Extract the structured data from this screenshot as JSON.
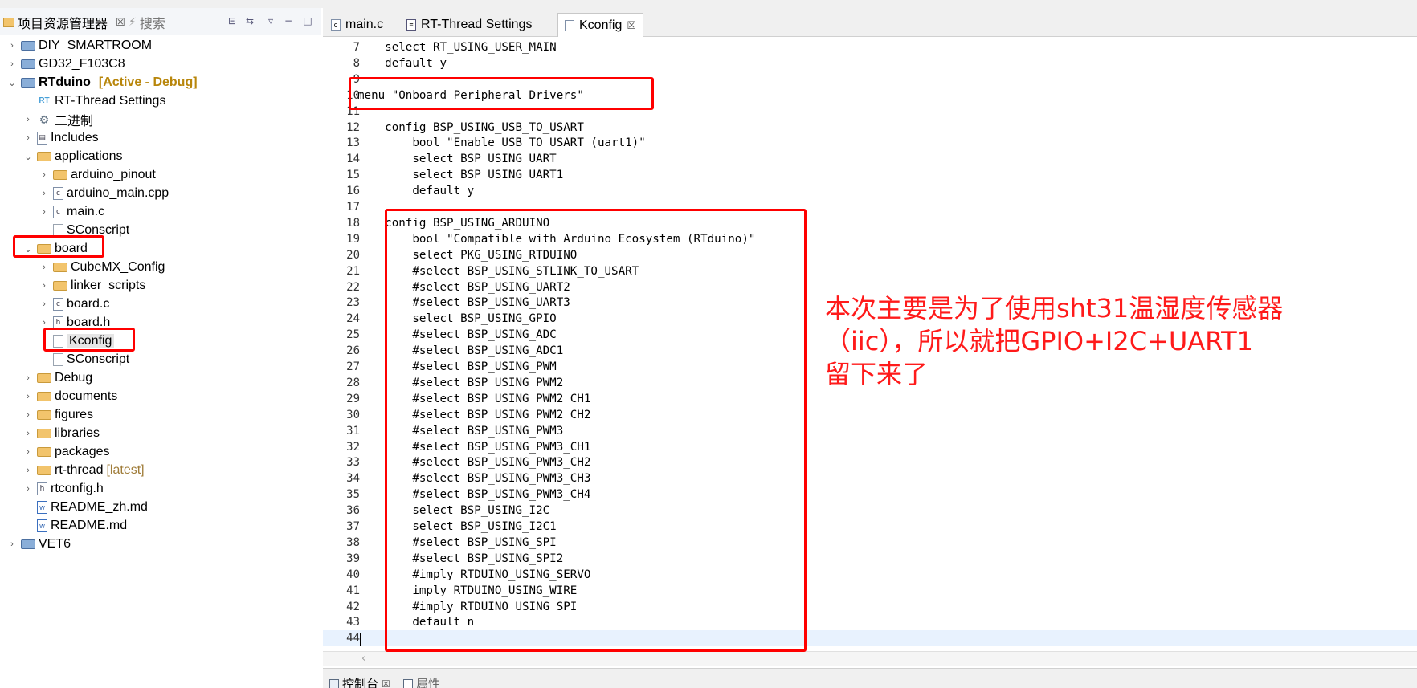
{
  "left_panel": {
    "tabs": [
      {
        "label": "项目资源管理器",
        "close": "☒"
      },
      {
        "label": "搜索"
      }
    ],
    "tree": [
      {
        "label": "DIY_SMARTROOM",
        "icon": "project-icon",
        "chev": "›",
        "indent": 0
      },
      {
        "label": "GD32_F103C8",
        "icon": "project-icon",
        "chev": "›",
        "indent": 0
      },
      {
        "label": "RTduino",
        "icon": "project-icon",
        "chev": "⌄",
        "indent": 0,
        "decoration": "[Active - Debug]"
      },
      {
        "label": "RT-Thread Settings",
        "icon": "rt-settings-icon",
        "chev": "",
        "indent": 1
      },
      {
        "label": "二进制",
        "icon": "binaries-icon",
        "chev": "›",
        "indent": 1
      },
      {
        "label": "Includes",
        "icon": "includes-icon",
        "chev": "›",
        "indent": 1
      },
      {
        "label": "applications",
        "icon": "folder-icon",
        "chev": "⌄",
        "indent": 1
      },
      {
        "label": "arduino_pinout",
        "icon": "folder-icon",
        "chev": "›",
        "indent": 2
      },
      {
        "label": "arduino_main.cpp",
        "icon": "c-file-icon",
        "chev": "›",
        "indent": 2
      },
      {
        "label": "main.c",
        "icon": "c-file-icon",
        "chev": "›",
        "indent": 2
      },
      {
        "label": "SConscript",
        "icon": "file-icon",
        "chev": "",
        "indent": 2
      },
      {
        "label": "board",
        "icon": "folder-icon",
        "chev": "⌄",
        "indent": 1
      },
      {
        "label": "CubeMX_Config",
        "icon": "folder-icon",
        "chev": "›",
        "indent": 2
      },
      {
        "label": "linker_scripts",
        "icon": "folder-icon",
        "chev": "›",
        "indent": 2
      },
      {
        "label": "board.c",
        "icon": "c-file-icon",
        "chev": "›",
        "indent": 2
      },
      {
        "label": "board.h",
        "icon": "h-file-icon",
        "chev": "›",
        "indent": 2
      },
      {
        "label": "Kconfig",
        "icon": "file-icon",
        "chev": "",
        "indent": 2,
        "selected": true
      },
      {
        "label": "SConscript",
        "icon": "file-icon",
        "chev": "",
        "indent": 2
      },
      {
        "label": "Debug",
        "icon": "folder-icon",
        "chev": "›",
        "indent": 1
      },
      {
        "label": "documents",
        "icon": "folder-icon",
        "chev": "›",
        "indent": 1
      },
      {
        "label": "figures",
        "icon": "folder-icon",
        "chev": "›",
        "indent": 1
      },
      {
        "label": "libraries",
        "icon": "folder-icon",
        "chev": "›",
        "indent": 1
      },
      {
        "label": "packages",
        "icon": "folder-icon",
        "chev": "›",
        "indent": 1
      },
      {
        "label": "rt-thread",
        "icon": "folder-icon",
        "chev": "›",
        "indent": 1,
        "decoration": "[latest]"
      },
      {
        "label": "rtconfig.h",
        "icon": "h-file-icon",
        "chev": "›",
        "indent": 1
      },
      {
        "label": "README_zh.md",
        "icon": "word-file-icon",
        "chev": "",
        "indent": 1
      },
      {
        "label": "README.md",
        "icon": "word-file-icon",
        "chev": "",
        "indent": 1
      },
      {
        "label": "VET6",
        "icon": "project-icon",
        "chev": "›",
        "indent": 0
      }
    ]
  },
  "editor": {
    "tabs": [
      {
        "label": "main.c",
        "icon": "c-file-icon",
        "active": false
      },
      {
        "label": "RT-Thread Settings",
        "icon": "rt-settings-icon",
        "active": false
      },
      {
        "label": "Kconfig",
        "icon": "file-icon",
        "active": true,
        "close": "☒"
      }
    ],
    "lines": [
      {
        "n": "7",
        "text": "    select RT_USING_USER_MAIN"
      },
      {
        "n": "8",
        "text": "    default y"
      },
      {
        "n": "9",
        "text": ""
      },
      {
        "n": "10",
        "text": "menu \"Onboard Peripheral Drivers\""
      },
      {
        "n": "11",
        "text": ""
      },
      {
        "n": "12",
        "text": "    config BSP_USING_USB_TO_USART"
      },
      {
        "n": "13",
        "text": "        bool \"Enable USB TO USART (uart1)\""
      },
      {
        "n": "14",
        "text": "        select BSP_USING_UART"
      },
      {
        "n": "15",
        "text": "        select BSP_USING_UART1"
      },
      {
        "n": "16",
        "text": "        default y"
      },
      {
        "n": "17",
        "text": ""
      },
      {
        "n": "18",
        "text": "    config BSP_USING_ARDUINO"
      },
      {
        "n": "19",
        "text": "        bool \"Compatible with Arduino Ecosystem (RTduino)\""
      },
      {
        "n": "20",
        "text": "        select PKG_USING_RTDUINO"
      },
      {
        "n": "21",
        "text": "        #select BSP_USING_STLINK_TO_USART"
      },
      {
        "n": "22",
        "text": "        #select BSP_USING_UART2"
      },
      {
        "n": "23",
        "text": "        #select BSP_USING_UART3"
      },
      {
        "n": "24",
        "text": "        select BSP_USING_GPIO"
      },
      {
        "n": "25",
        "text": "        #select BSP_USING_ADC"
      },
      {
        "n": "26",
        "text": "        #select BSP_USING_ADC1"
      },
      {
        "n": "27",
        "text": "        #select BSP_USING_PWM"
      },
      {
        "n": "28",
        "text": "        #select BSP_USING_PWM2"
      },
      {
        "n": "29",
        "text": "        #select BSP_USING_PWM2_CH1"
      },
      {
        "n": "30",
        "text": "        #select BSP_USING_PWM2_CH2"
      },
      {
        "n": "31",
        "text": "        #select BSP_USING_PWM3"
      },
      {
        "n": "32",
        "text": "        #select BSP_USING_PWM3_CH1"
      },
      {
        "n": "33",
        "text": "        #select BSP_USING_PWM3_CH2"
      },
      {
        "n": "34",
        "text": "        #select BSP_USING_PWM3_CH3"
      },
      {
        "n": "35",
        "text": "        #select BSP_USING_PWM3_CH4"
      },
      {
        "n": "36",
        "text": "        select BSP_USING_I2C"
      },
      {
        "n": "37",
        "text": "        select BSP_USING_I2C1"
      },
      {
        "n": "38",
        "text": "        #select BSP_USING_SPI"
      },
      {
        "n": "39",
        "text": "        #select BSP_USING_SPI2"
      },
      {
        "n": "40",
        "text": "        #imply RTDUINO_USING_SERVO"
      },
      {
        "n": "41",
        "text": "        imply RTDUINO_USING_WIRE"
      },
      {
        "n": "42",
        "text": "        #imply RTDUINO_USING_SPI"
      },
      {
        "n": "43",
        "text": "        default n"
      },
      {
        "n": "44",
        "text": ""
      }
    ]
  },
  "bottom": {
    "tabs": [
      {
        "label": "控制台",
        "close": "☒"
      },
      {
        "label": "属性"
      }
    ]
  },
  "annotation": {
    "lines": [
      "本次主要是为了使用sht31温湿度传感器",
      "（iic），所以就把GPIO+I2C+UART1",
      "留下来了"
    ]
  },
  "colors": {
    "annotation": "#ff1a1a",
    "highlight_box": "#ff0000",
    "selection": "#e5e5e5",
    "current_line": "#e8f2fe"
  }
}
